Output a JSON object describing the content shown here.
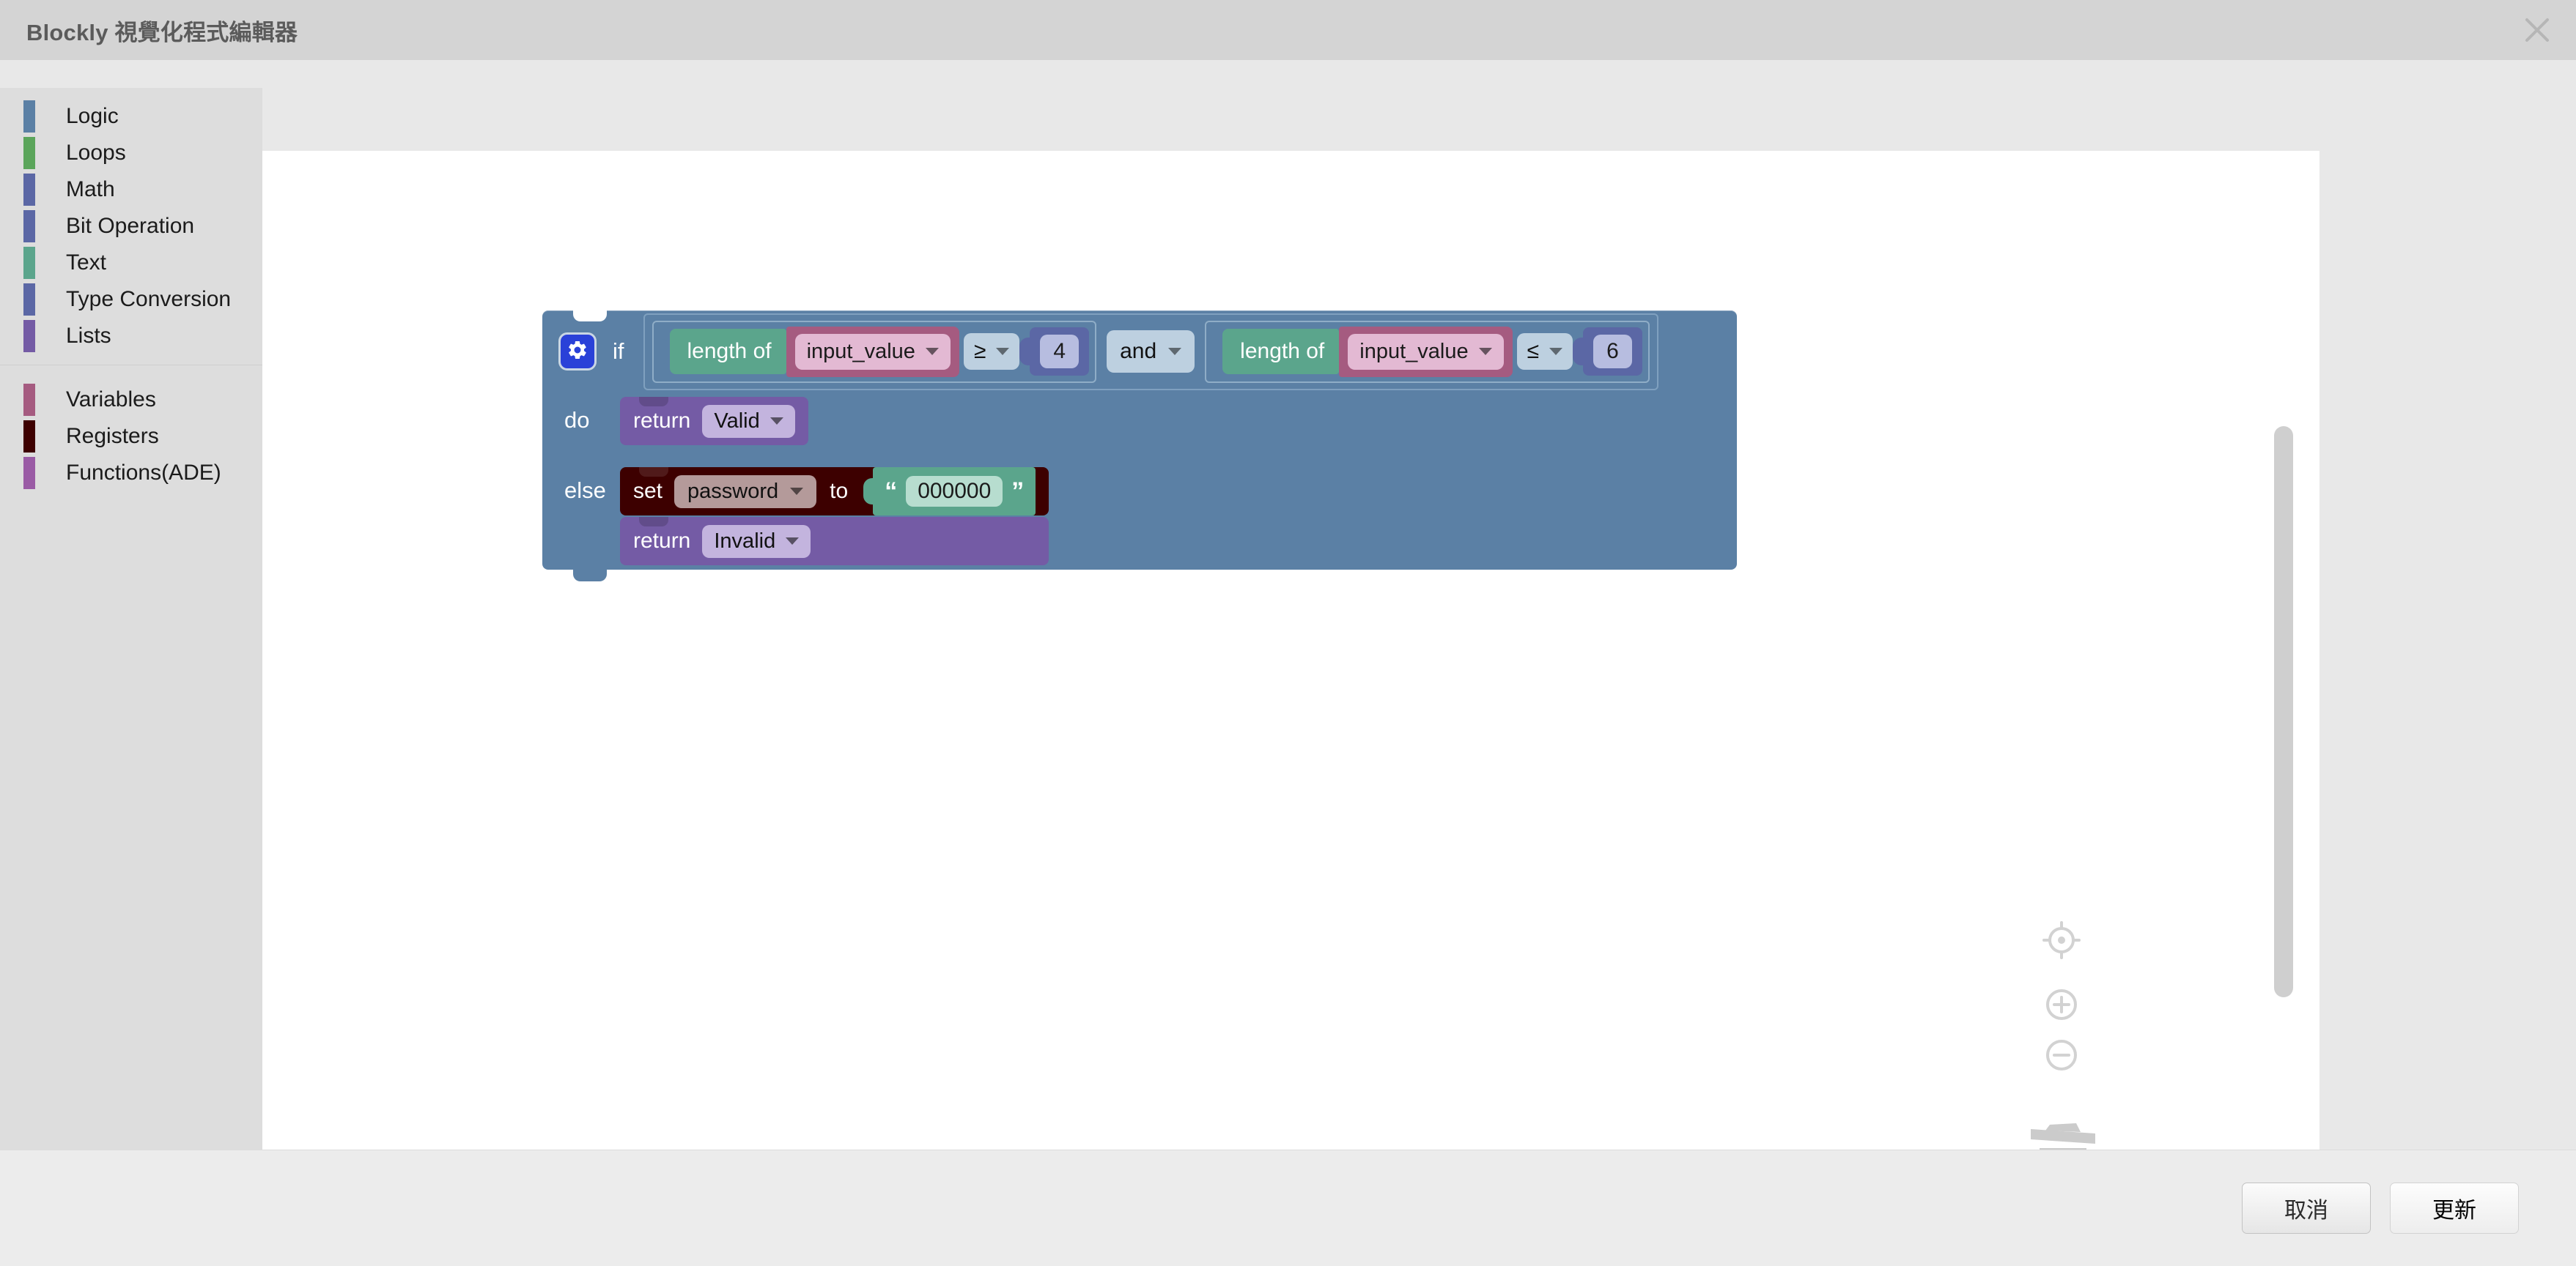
{
  "window": {
    "title": "Blockly 視覺化程式編輯器",
    "close_icon": "close-icon"
  },
  "toolbox": {
    "groups": [
      {
        "items": [
          {
            "label": "Logic",
            "color": "#5b80a5"
          },
          {
            "label": "Loops",
            "color": "#5ba55b"
          },
          {
            "label": "Math",
            "color": "#5b67a5"
          },
          {
            "label": "Bit Operation",
            "color": "#5b67a5"
          },
          {
            "label": "Text",
            "color": "#5ba58c"
          },
          {
            "label": "Type Conversion",
            "color": "#5b67a5"
          },
          {
            "label": "Lists",
            "color": "#745ba5"
          }
        ]
      },
      {
        "items": [
          {
            "label": "Variables",
            "color": "#a55b80"
          },
          {
            "label": "Registers",
            "color": "#3d0000"
          },
          {
            "label": "Functions(ADE)",
            "color": "#9a5ba5"
          }
        ]
      }
    ]
  },
  "workspace": {
    "blocks": {
      "if_block": {
        "gear_icon": "gear-icon",
        "if_label": "if",
        "condition": {
          "left": {
            "length_of_label": "length of",
            "variable": "input_value",
            "operator": "≥",
            "number": "4"
          },
          "joiner": "and",
          "right": {
            "length_of_label": "length of",
            "variable": "input_value",
            "operator": "≤",
            "number": "6"
          }
        },
        "do_label": "do",
        "do_statements": [
          {
            "kind": "return",
            "keyword": "return",
            "value": "Valid"
          }
        ],
        "else_label": "else",
        "else_statements": [
          {
            "kind": "set",
            "keyword": "set",
            "target": "password",
            "to_label": "to",
            "open_quote": "“",
            "string_value": "000000",
            "close_quote": "”"
          },
          {
            "kind": "return",
            "keyword": "return",
            "value": "Invalid"
          }
        ]
      }
    },
    "controls": [
      {
        "name": "center-target-icon"
      },
      {
        "name": "zoom-in-icon"
      },
      {
        "name": "zoom-out-icon"
      },
      {
        "name": "trash-icon"
      }
    ],
    "scrollbars": {
      "vertical": "vertical-scrollbar",
      "horizontal": "horizontal-scrollbar"
    }
  },
  "footer": {
    "cancel_label": "取消",
    "update_label": "更新"
  },
  "colors": {
    "logic": "#5b80a5",
    "loops": "#5ba55b",
    "math": "#5b67a5",
    "text": "#5ba58c",
    "lists": "#745ba5",
    "variables": "#a55b80",
    "registers": "#3d0000",
    "functions": "#9a5ba5",
    "titlebar_bg": "#d4d4d4",
    "toolbox_bg": "#dddddd",
    "workspace_bg": "#ffffff",
    "footer_bg": "#ececec"
  }
}
